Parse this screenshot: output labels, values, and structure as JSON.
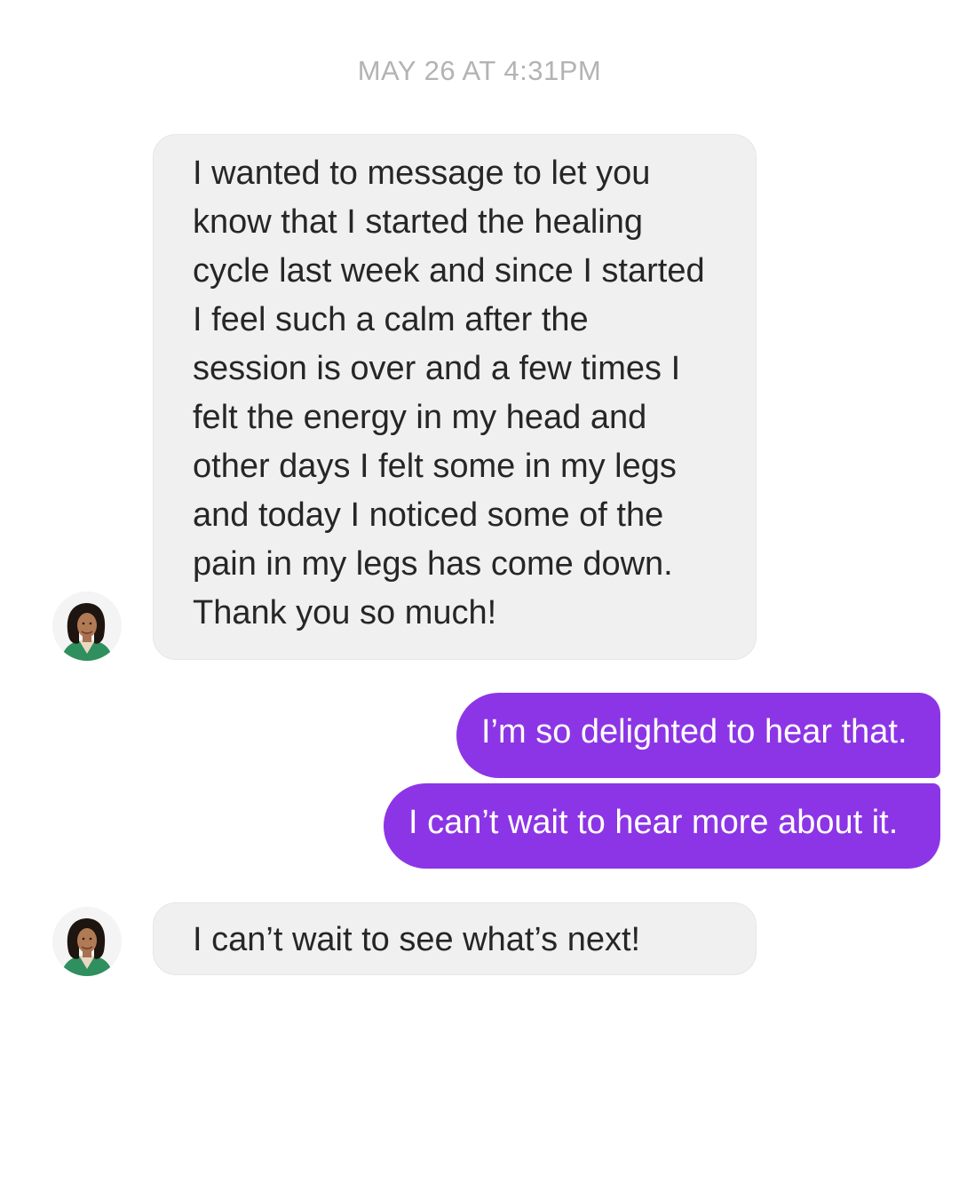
{
  "conversation": {
    "timestamp": "MAY 26 AT 4:31PM",
    "incoming_first": {
      "lines": [
        "I wanted to message to let you",
        "know that I started the healing",
        "cycle last week and since I started",
        "I feel such a calm after the",
        "session is over and a few times I",
        "felt the energy in my head and",
        "other days I felt some in my legs",
        "and today I noticed some of the",
        "pain in my legs has come down.",
        "Thank you so much!"
      ]
    },
    "outgoing": [
      {
        "text": "I’m so delighted to hear that."
      },
      {
        "text": "I can’t wait to hear more about it."
      }
    ],
    "incoming_second": {
      "text": "I can’t wait to see what’s next!"
    },
    "avatar_icon": "profile-photo-woman"
  },
  "colors": {
    "outgoing_bubble": "#8c35e6",
    "incoming_bubble": "#f0f0f0",
    "timestamp_text": "#b3b3b3"
  }
}
